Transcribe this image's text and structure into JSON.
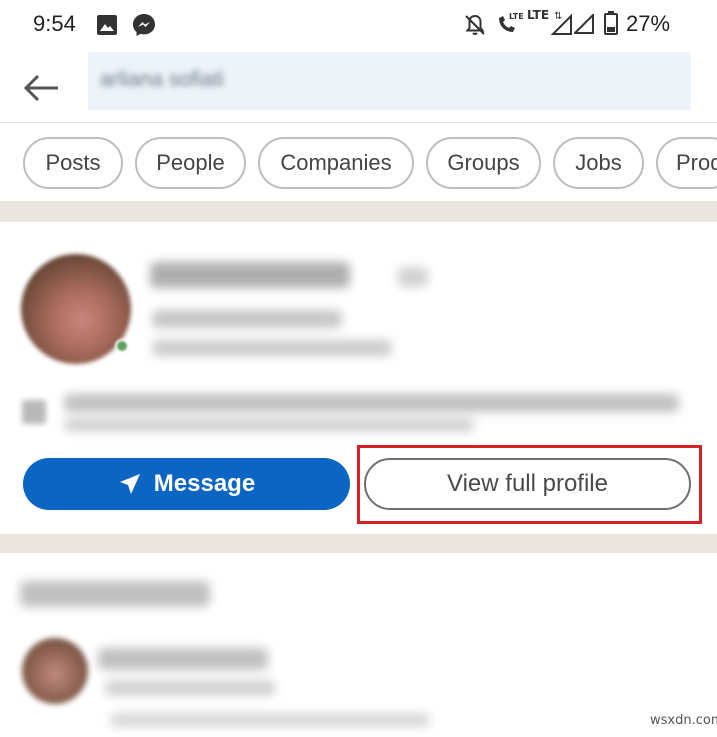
{
  "status_bar": {
    "time": "9:54",
    "battery": "27%",
    "icons": [
      "image-icon",
      "messenger-icon",
      "mute-icon",
      "lte-call-icon",
      "lte-signal-icon",
      "signal-icon",
      "battery-icon"
    ]
  },
  "search": {
    "back_icon": "arrow-left-icon",
    "query": "arliana sofiati"
  },
  "filters": [
    "Posts",
    "People",
    "Companies",
    "Groups",
    "Jobs",
    "Prod"
  ],
  "profile_card": {
    "message_label": "Message",
    "message_icon": "send-icon",
    "view_profile_label": "View full profile"
  },
  "colors": {
    "primary_button": "#0a66c2",
    "highlight": "#d81f26",
    "feed_background": "#eae6df"
  },
  "watermark": "wsxdn.com"
}
